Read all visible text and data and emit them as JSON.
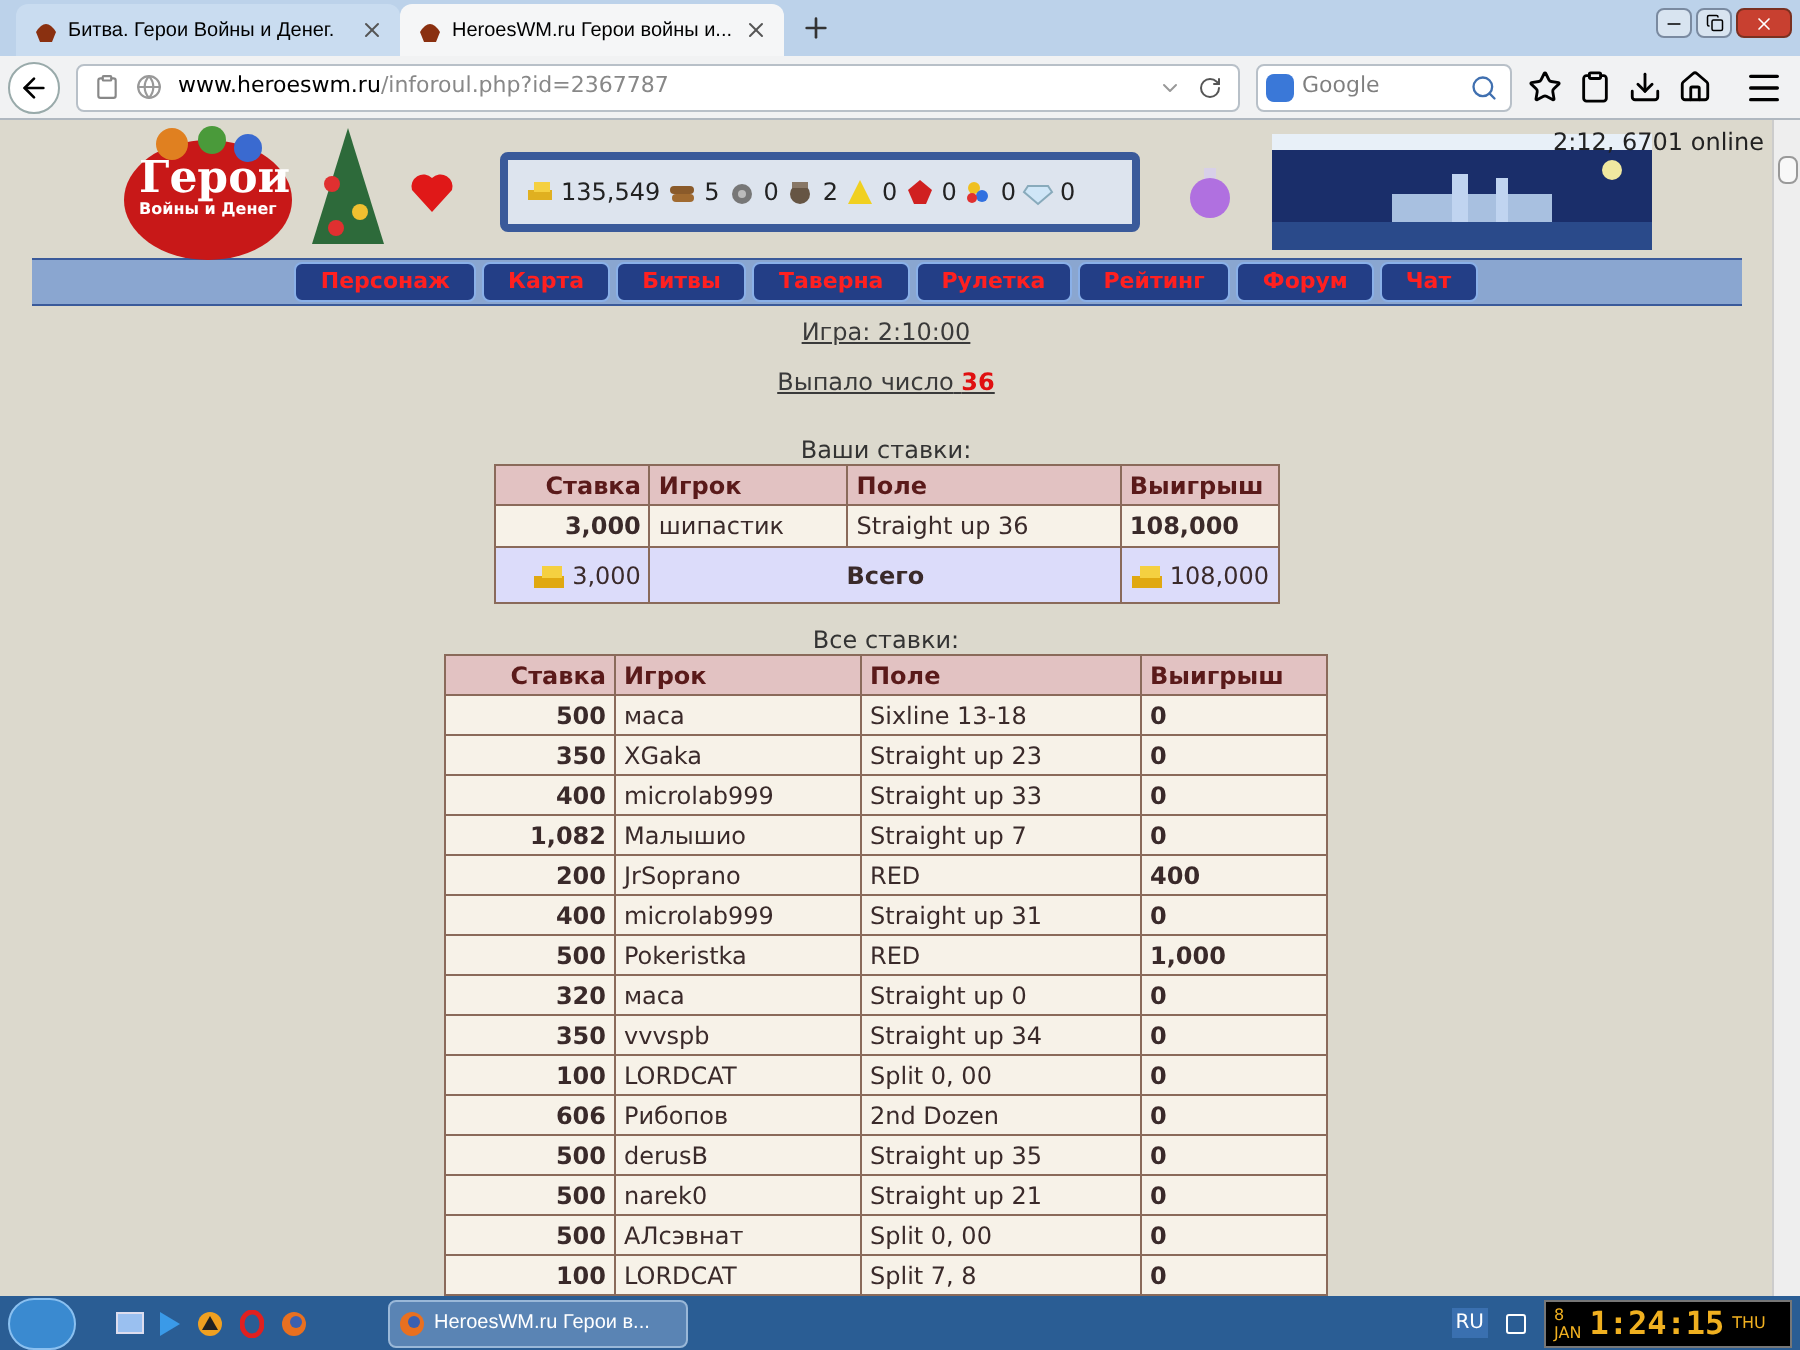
{
  "browser": {
    "tabs": [
      {
        "title": "Битва. Герои Войны и Денег.",
        "selected": false
      },
      {
        "title": "HeroesWM.ru Герои войны и...",
        "selected": true
      }
    ],
    "url_host": "www.heroeswm.ru",
    "url_path": "/inforoul.php?id=2367787",
    "search_placeholder": "Google"
  },
  "header": {
    "logo_title": "Герои",
    "logo_subtitle": "Войны и Денег",
    "online": "2:12, 6701 online",
    "resources": [
      {
        "kind": "gold",
        "value": "135,549"
      },
      {
        "kind": "wood",
        "value": "5"
      },
      {
        "kind": "ore",
        "value": "0"
      },
      {
        "kind": "mercury",
        "value": "2"
      },
      {
        "kind": "sulfur",
        "value": "0"
      },
      {
        "kind": "crystal",
        "value": "0"
      },
      {
        "kind": "gem",
        "value": "0"
      },
      {
        "kind": "diamond",
        "value": "0"
      }
    ],
    "nav": [
      "Персонаж",
      "Карта",
      "Битвы",
      "Таверна",
      "Рулетка",
      "Рейтинг",
      "Форум",
      "Чат"
    ]
  },
  "game_link": "Игра: 2:10:00",
  "result": {
    "label": "Выпало число",
    "number": "36"
  },
  "your_bets": {
    "title": "Ваши ставки:",
    "columns": [
      "Ставка",
      "Игрок",
      "Поле",
      "Выигрыш"
    ],
    "rows": [
      {
        "bet": "3,000",
        "player": "шипастик",
        "field": "Straight up 36",
        "win": "108,000"
      }
    ],
    "total": {
      "bet": "3,000",
      "label": "Всего",
      "win": "108,000"
    }
  },
  "all_bets": {
    "title": "Все ставки:",
    "columns": [
      "Ставка",
      "Игрок",
      "Поле",
      "Выигрыш"
    ],
    "rows": [
      {
        "bet": "500",
        "player": "маса",
        "field": "Sixline 13-18",
        "win": "0"
      },
      {
        "bet": "350",
        "player": "XGaka",
        "field": "Straight up 23",
        "win": "0"
      },
      {
        "bet": "400",
        "player": "microlab999",
        "field": "Straight up 33",
        "win": "0"
      },
      {
        "bet": "1,082",
        "player": "Малышио",
        "field": "Straight up 7",
        "win": "0"
      },
      {
        "bet": "200",
        "player": "JrSoprano",
        "field": "RED",
        "win": "400"
      },
      {
        "bet": "400",
        "player": "microlab999",
        "field": "Straight up 31",
        "win": "0"
      },
      {
        "bet": "500",
        "player": "Pokeristka",
        "field": "RED",
        "win": "1,000"
      },
      {
        "bet": "320",
        "player": "маса",
        "field": "Straight up 0",
        "win": "0"
      },
      {
        "bet": "350",
        "player": "vvvspb",
        "field": "Straight up 34",
        "win": "0"
      },
      {
        "bet": "100",
        "player": "LORDCAT",
        "field": "Split 0, 00",
        "win": "0"
      },
      {
        "bet": "606",
        "player": "Рибопов",
        "field": "2nd Dozen",
        "win": "0"
      },
      {
        "bet": "500",
        "player": "derusB",
        "field": "Straight up 35",
        "win": "0"
      },
      {
        "bet": "500",
        "player": "narek0",
        "field": "Straight up 21",
        "win": "0"
      },
      {
        "bet": "500",
        "player": "АЛсэвнат",
        "field": "Split 0, 00",
        "win": "0"
      },
      {
        "bet": "100",
        "player": "LORDCAT",
        "field": "Split 7, 8",
        "win": "0"
      }
    ]
  },
  "taskbar": {
    "window": "HeroesWM.ru Герои в...",
    "language": "RU",
    "clock_day": "8",
    "clock_month": "JAN",
    "clock_time": "1:24:15",
    "clock_weekday": "THU"
  }
}
